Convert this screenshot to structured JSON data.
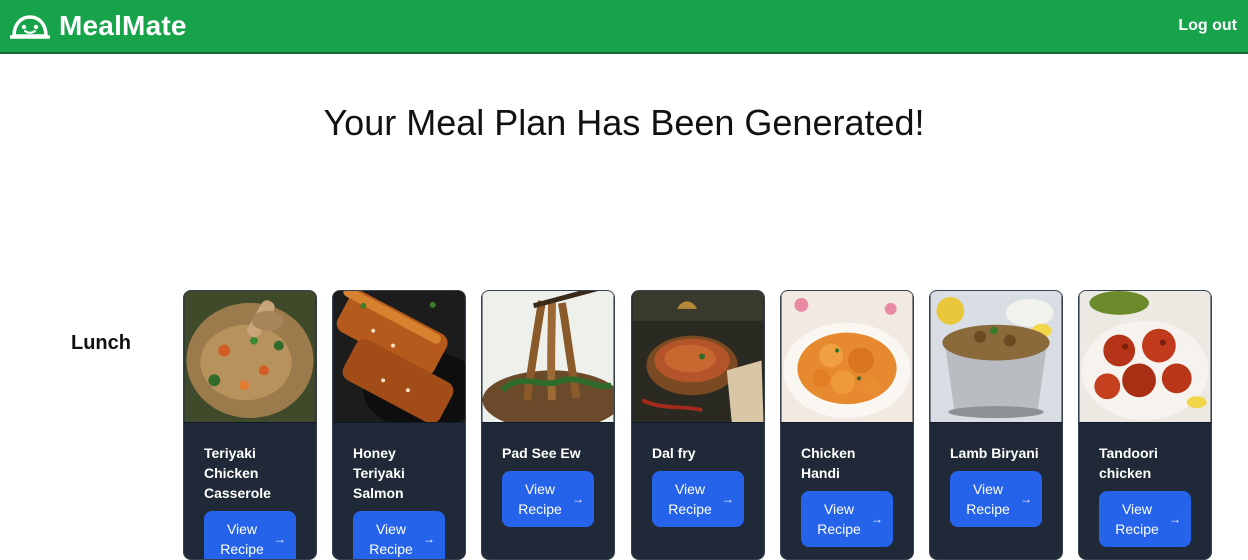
{
  "navbar": {
    "brand_icon": "smiling-bot-icon",
    "brand_name": "MealMate",
    "logout_label": "Log out",
    "color": "#16a34a"
  },
  "main": {
    "title": "Your Meal Plan Has Been Generated!"
  },
  "meal_sections": [
    {
      "label": "Lunch",
      "cards": [
        {
          "name": "Teriyaki Chicken Casserole",
          "button_label": "View Recipe",
          "button_icon": "arrow-right-icon"
        },
        {
          "name": "Honey Teriyaki Salmon",
          "button_label": "View Recipe",
          "button_icon": "arrow-right-icon"
        },
        {
          "name": "Pad See Ew",
          "button_label": "View Recipe",
          "button_icon": "arrow-right-icon"
        },
        {
          "name": "Dal fry",
          "button_label": "View Recipe",
          "button_icon": "arrow-right-icon"
        },
        {
          "name": "Chicken Handi",
          "button_label": "View Recipe",
          "button_icon": "arrow-right-icon"
        },
        {
          "name": "Lamb Biryani",
          "button_label": "View Recipe",
          "button_icon": "arrow-right-icon"
        },
        {
          "name": "Tandoori chicken",
          "button_label": "View Recipe",
          "button_icon": "arrow-right-icon"
        }
      ]
    }
  ],
  "colors": {
    "card_bg": "#1f2937",
    "button_bg": "#2563eb"
  }
}
